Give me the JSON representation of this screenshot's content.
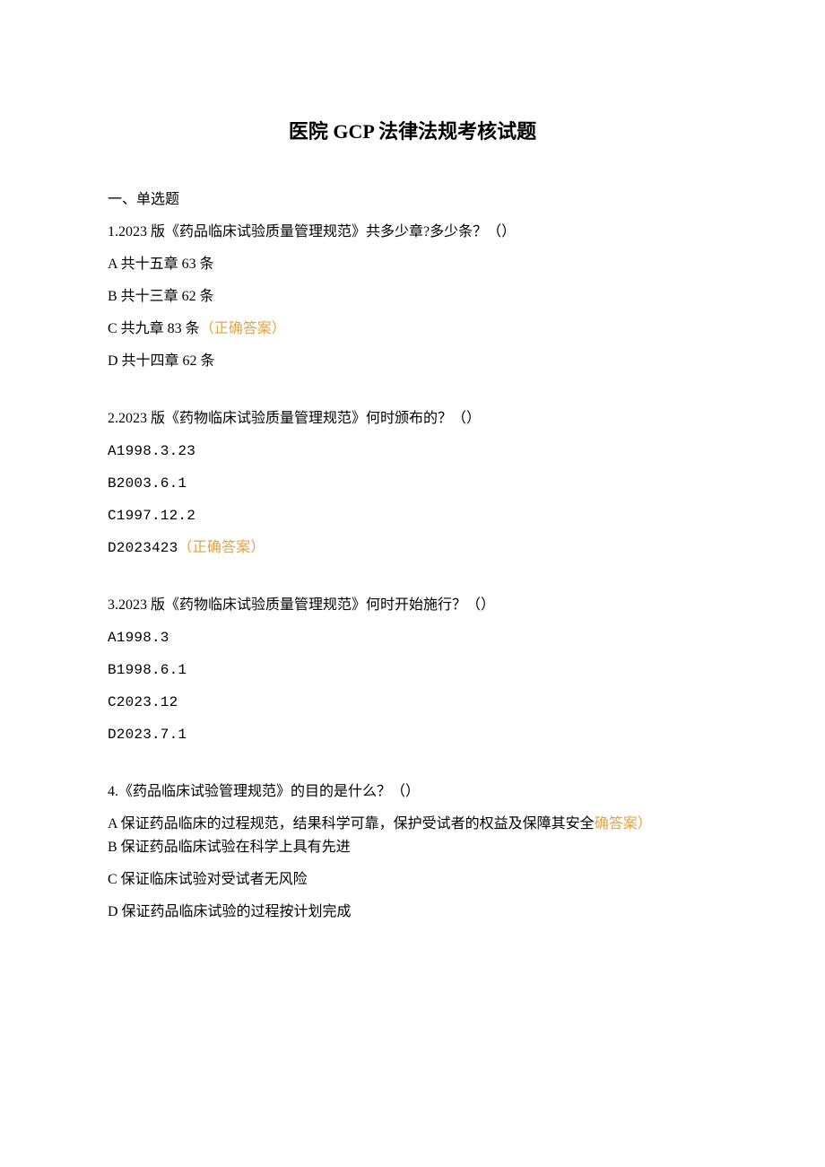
{
  "title_pre": "医院 ",
  "title_latin": "GCP ",
  "title_post": "法律法规考核试题",
  "section": "一、单选题",
  "q1": {
    "text": "1.2023 版《药品临床试验质量管理规范》共多少章?多少条？（）",
    "a": "A 共十五章 63 条",
    "b": "B 共十三章 62 条",
    "c": "C 共九章 83 条",
    "c_ans": "（正确答案）",
    "d": "D 共十四章 62 条"
  },
  "q2": {
    "text": "2.2023 版《药物临床试验质量管理规范》何时颁布的？（）",
    "a": "A1998.3.23",
    "b": "B2003.6.1",
    "c": "C1997.12.2",
    "d": "D2023423",
    "d_ans": "（正确答案）"
  },
  "q3": {
    "text": "3.2023 版《药物临床试验质量管理规范》何时开始施行？（）",
    "a": "A1998.3",
    "b": "B1998.6.1",
    "c": "C2023.12",
    "d": "D2023.7.1"
  },
  "q4": {
    "text": "4.《药品临床试验管理规范》的目的是什么？（）",
    "a_pre": "A 保证药品临床的过程规范，结果科学可靠，保护受试者的权益及保障其安全",
    "a_ans": "确答案）",
    "b": "B 保证药品临床试验在科学上具有先进",
    "c": "C 保证临床试验对受试者无风险",
    "d": "D 保证药品临床试验的过程按计划完成"
  }
}
